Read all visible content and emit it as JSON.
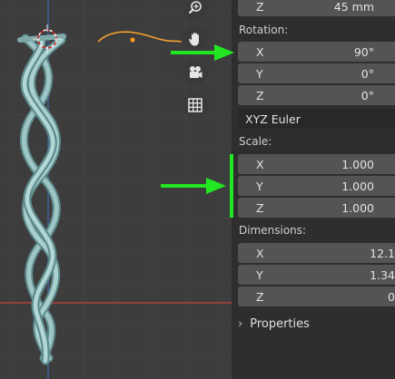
{
  "transform": {
    "location": {
      "z": {
        "axis": "Z",
        "value": "45 mm"
      }
    },
    "rotation": {
      "label": "Rotation:",
      "x": {
        "axis": "X",
        "value": "90°"
      },
      "y": {
        "axis": "Y",
        "value": "0°"
      },
      "z": {
        "axis": "Z",
        "value": "0°"
      },
      "mode": "XYZ Euler"
    },
    "scale": {
      "label": "Scale:",
      "x": {
        "axis": "X",
        "value": "1.000"
      },
      "y": {
        "axis": "Y",
        "value": "1.000"
      },
      "z": {
        "axis": "Z",
        "value": "1.000"
      }
    },
    "dimensions": {
      "label": "Dimensions:",
      "x": {
        "axis": "X",
        "value": "12.1"
      },
      "y": {
        "axis": "Y",
        "value": "1.34"
      },
      "z": {
        "axis": "Z",
        "value": "0"
      }
    }
  },
  "properties": {
    "label": "Properties"
  },
  "icons": {
    "zoom": "zoom-icon",
    "pan": "hand-icon",
    "camera": "camera-icon",
    "grid": "grid-icon"
  },
  "colors": {
    "annotation": "#22e622",
    "braid": "#8ab4b5",
    "curve": "#f0a030",
    "axis_red": "#c44242",
    "axis_blue": "#4a6fa8"
  }
}
